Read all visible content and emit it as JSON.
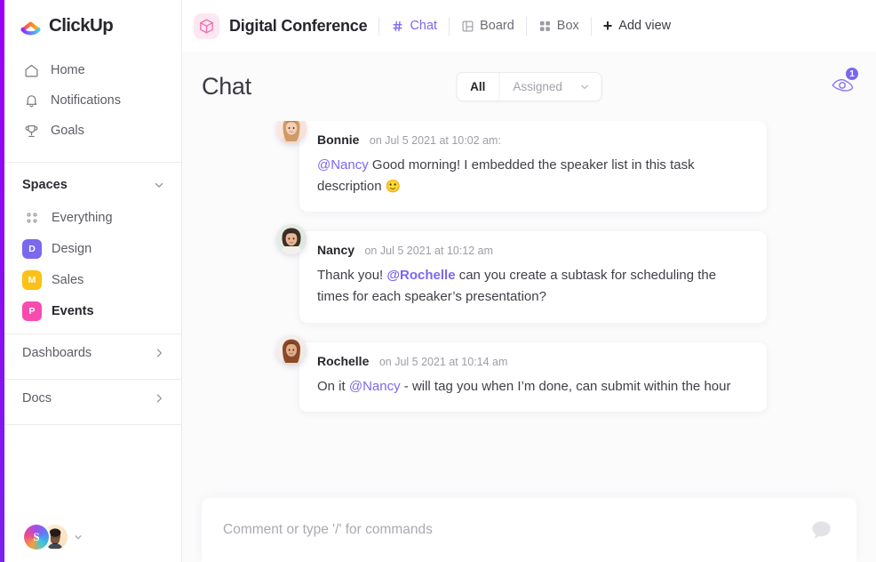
{
  "app": {
    "logo_text": "ClickUp",
    "accent_color": "#7b68ee",
    "edge_strip_color": "#8b00f0"
  },
  "sidebar": {
    "nav": [
      {
        "label": "Home",
        "icon": "home-icon"
      },
      {
        "label": "Notifications",
        "icon": "bell-icon"
      },
      {
        "label": "Goals",
        "icon": "trophy-icon"
      }
    ],
    "spaces_header": "Spaces",
    "spaces": [
      {
        "label": "Everything",
        "icon": "grid-dots-icon",
        "badge": "",
        "color": ""
      },
      {
        "label": "Design",
        "icon": "space-badge",
        "badge": "D",
        "color": "#7b68ee"
      },
      {
        "label": "Sales",
        "icon": "space-badge",
        "badge": "M",
        "color": "#fbc116"
      },
      {
        "label": "Events",
        "icon": "space-badge",
        "badge": "P",
        "color": "#f74bb0"
      }
    ],
    "links": [
      {
        "label": "Dashboards",
        "icon": "chevron-right-icon"
      },
      {
        "label": "Docs",
        "icon": "chevron-right-icon"
      }
    ],
    "user": {
      "workspace_initial": "S",
      "avatar_name": "user-avatar"
    }
  },
  "topbar": {
    "project_name": "Digital Conference",
    "project_icon": "box-cube-icon",
    "views": [
      {
        "label": "Chat",
        "icon": "hash-icon",
        "active": true
      },
      {
        "label": "Board",
        "icon": "board-icon",
        "active": false
      },
      {
        "label": "Box",
        "icon": "box-grid-icon",
        "active": false
      }
    ],
    "add_view_label": "Add view",
    "add_view_icon": "plus-icon"
  },
  "chat": {
    "title": "Chat",
    "filter": {
      "all_label": "All",
      "assigned_label": "Assigned",
      "selected": "All",
      "caret_icon": "chevron-down-icon"
    },
    "watchers": {
      "icon": "eye-icon",
      "count": "1"
    },
    "messages": [
      {
        "author": "Bonnie",
        "timestamp": "on Jul 5 2021 at 10:02 am:",
        "avatar_name": "avatar-bonnie",
        "mention": "@Nancy",
        "mention_bold": false,
        "mention_position": "start",
        "text_before": "",
        "text_after": " Good morning! I embedded the speaker list in this task description ",
        "emoji": "🙂"
      },
      {
        "author": "Nancy",
        "timestamp": "on Jul 5 2021 at 10:12 am",
        "avatar_name": "avatar-nancy",
        "mention": "@Rochelle",
        "mention_bold": true,
        "mention_position": "middle",
        "text_before": "Thank you! ",
        "text_after": " can you create a subtask for scheduling the times for each speaker’s presentation?",
        "emoji": ""
      },
      {
        "author": "Rochelle",
        "timestamp": "on Jul 5 2021 at 10:14 am",
        "avatar_name": "avatar-rochelle",
        "mention": "@Nancy",
        "mention_bold": false,
        "mention_position": "middle",
        "text_before": "On it ",
        "text_after": " - will tag you when I’m done, can submit within the hour",
        "emoji": ""
      }
    ],
    "composer": {
      "placeholder": "Comment or type '/' for commands",
      "value": "",
      "icon": "comment-bubble-icon"
    }
  }
}
